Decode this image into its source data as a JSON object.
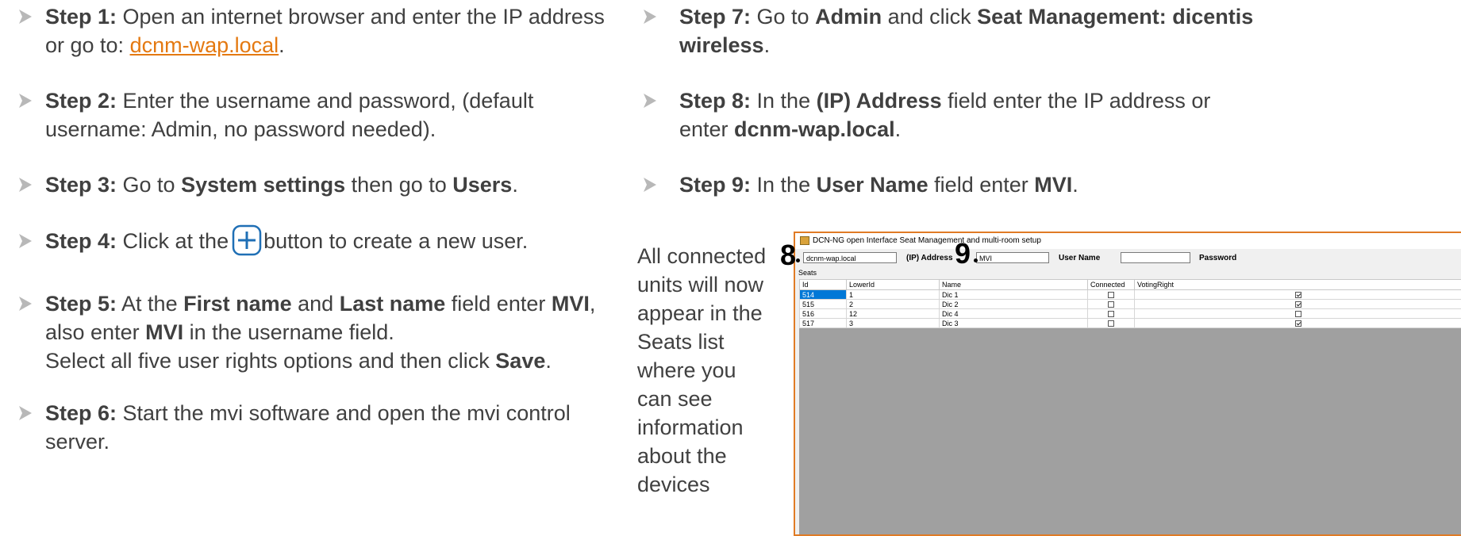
{
  "left_steps": [
    {
      "label": "Step 1:",
      "parts": [
        " Open an internet browser and enter the IP address or go to: "
      ],
      "link": "dcnm-wap.local",
      "tail": "."
    },
    {
      "label": "Step 2:",
      "text": " Enter the username and password, (default username: Admin, no password needed)."
    },
    {
      "label": "Step 3:",
      "t1": " Go to ",
      "b1": "System settings",
      "t2": " then go to ",
      "b2": "Users",
      "t3": "."
    },
    {
      "label": "Step 4:",
      "t1": " Click at the",
      "t2": "button to create a new user."
    },
    {
      "label": "Step 5:",
      "t1": " At the ",
      "b1": "First name",
      "t2": " and ",
      "b2": "Last name",
      "t3": " field enter ",
      "b3": "MVI",
      "t4": ",",
      "line2a": "also enter ",
      "line2b": "MVI",
      "line2c": " in the username field.",
      "line3a": "Select all five user rights options and then click ",
      "line3b": "Save",
      "line3c": "."
    },
    {
      "label": "Step 6:",
      "text": " Start the mvi software and open the mvi control server."
    }
  ],
  "right_steps": [
    {
      "label": "Step 7:",
      "t1": " Go to ",
      "b1": "Admin",
      "t2": " and click ",
      "b2": "Seat Management: dicentis",
      "b3": "wireless",
      "t3": "."
    },
    {
      "label": "Step 8:",
      "t1": " In the ",
      "b1": "(IP) Address",
      "t2": " field enter the IP address or",
      "t3": "enter ",
      "b2": "dcnm-wap.local",
      "t4": "."
    },
    {
      "label": "Step 9:",
      "t1": " In the ",
      "b1": "User Name",
      "t2": " field enter ",
      "b2": "MVI",
      "t3": "."
    }
  ],
  "side_text": "All connected units will now appear in the Seats list where you can see information about the devices",
  "callouts": {
    "eight": "8",
    "nine": "9"
  },
  "window": {
    "title": "DCN-NG open Interface Seat Management and multi-room setup",
    "ip_value": "dcnm-wap.local",
    "ip_label": "(IP) Address",
    "user_value": "MVI",
    "user_label": "User Name",
    "password_value": "",
    "password_label": "Password",
    "seats_label": "Seats",
    "columns": [
      "Id",
      "LowerId",
      "Name",
      "Connected",
      "VotingRight"
    ],
    "rows": [
      {
        "id": "514",
        "lower": "1",
        "name": "Dic 1",
        "connected": false,
        "voting": true
      },
      {
        "id": "515",
        "lower": "2",
        "name": "Dic 2",
        "connected": false,
        "voting": true
      },
      {
        "id": "516",
        "lower": "12",
        "name": "Dic 4",
        "connected": false,
        "voting": false
      },
      {
        "id": "517",
        "lower": "3",
        "name": "Dic 3",
        "connected": false,
        "voting": true
      }
    ]
  },
  "colors": {
    "link": "#E47911",
    "accent_border": "#E07B25",
    "selection": "#0078d7",
    "plus_icon": "#1f6fb5"
  }
}
